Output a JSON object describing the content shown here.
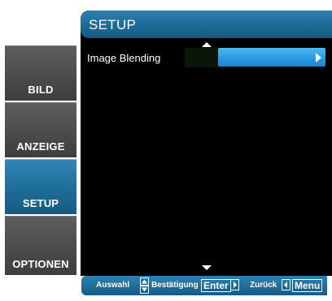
{
  "sidebar": {
    "items": [
      {
        "label": "BILD"
      },
      {
        "label": "ANZEIGE"
      },
      {
        "label": "SETUP",
        "active": true
      },
      {
        "label": "OPTIONEN"
      }
    ]
  },
  "menu": {
    "title": "SETUP",
    "items": [
      {
        "label": "Image Blending",
        "value": ""
      }
    ]
  },
  "footer": {
    "select_label": "Auswahl",
    "confirm_label": "Bestätigung",
    "enter_key": "Enter",
    "back_label": "Zurück",
    "menu_key": "Menu"
  },
  "colors": {
    "accent": "#1e6c99",
    "highlight": "#2d9be6",
    "background": "#000000"
  },
  "icons": [
    "up-arrow-icon",
    "down-arrow-icon",
    "right-caret-icon",
    "up-down-icon",
    "right-key-icon",
    "left-key-icon"
  ]
}
